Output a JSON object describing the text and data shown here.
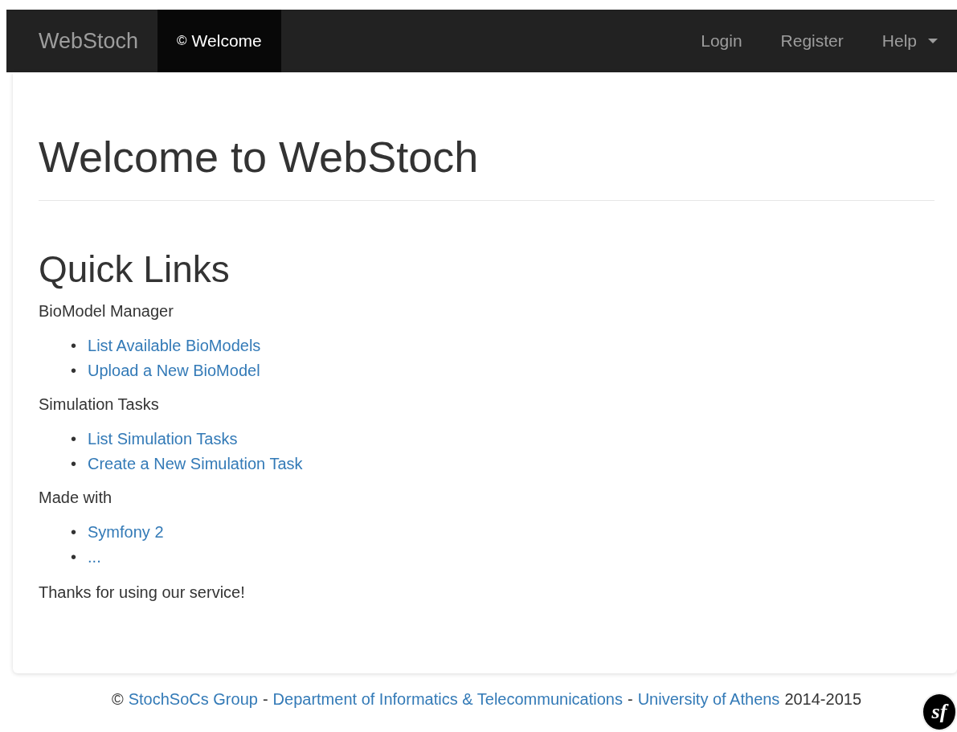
{
  "navbar": {
    "brand": "WebStoch",
    "left_items": [
      {
        "glyph": "©",
        "label": "Welcome",
        "selected": true
      }
    ],
    "right_items": [
      {
        "label": "Login",
        "kind": "link"
      },
      {
        "label": "Register",
        "kind": "link"
      },
      {
        "label": "Help",
        "kind": "dropdown"
      }
    ]
  },
  "content": {
    "title": "Welcome to WebStoch",
    "subtitle": "Quick Links",
    "sections": [
      {
        "heading": "BioModel Manager",
        "links": [
          {
            "bullet": "•",
            "text": "List Available BioModels"
          },
          {
            "bullet": "•",
            "text": "Upload a New BioModel"
          }
        ]
      },
      {
        "heading": "Simulation Tasks",
        "links": [
          {
            "bullet": "•",
            "text": "List Simulation Tasks"
          },
          {
            "bullet": "•",
            "text": "Create a New Simulation Task"
          }
        ]
      },
      {
        "heading": "Made with",
        "links": [
          {
            "bullet": "•",
            "text": "Symfony 2"
          },
          {
            "bullet": "•",
            "text": "..."
          }
        ]
      }
    ],
    "closing": "Thanks for using our service!"
  },
  "footer": {
    "parts": [
      {
        "kind": "text",
        "text": "©"
      },
      {
        "kind": "link",
        "text": "StochSoCs Group"
      },
      {
        "kind": "text",
        "text": "-"
      },
      {
        "kind": "link",
        "text": "Department of Informatics & Telecommunications"
      },
      {
        "kind": "text",
        "text": "-"
      },
      {
        "kind": "link",
        "text": "University of Athens"
      },
      {
        "kind": "text",
        "text": "2014-2015"
      }
    ],
    "badge": "sf"
  }
}
